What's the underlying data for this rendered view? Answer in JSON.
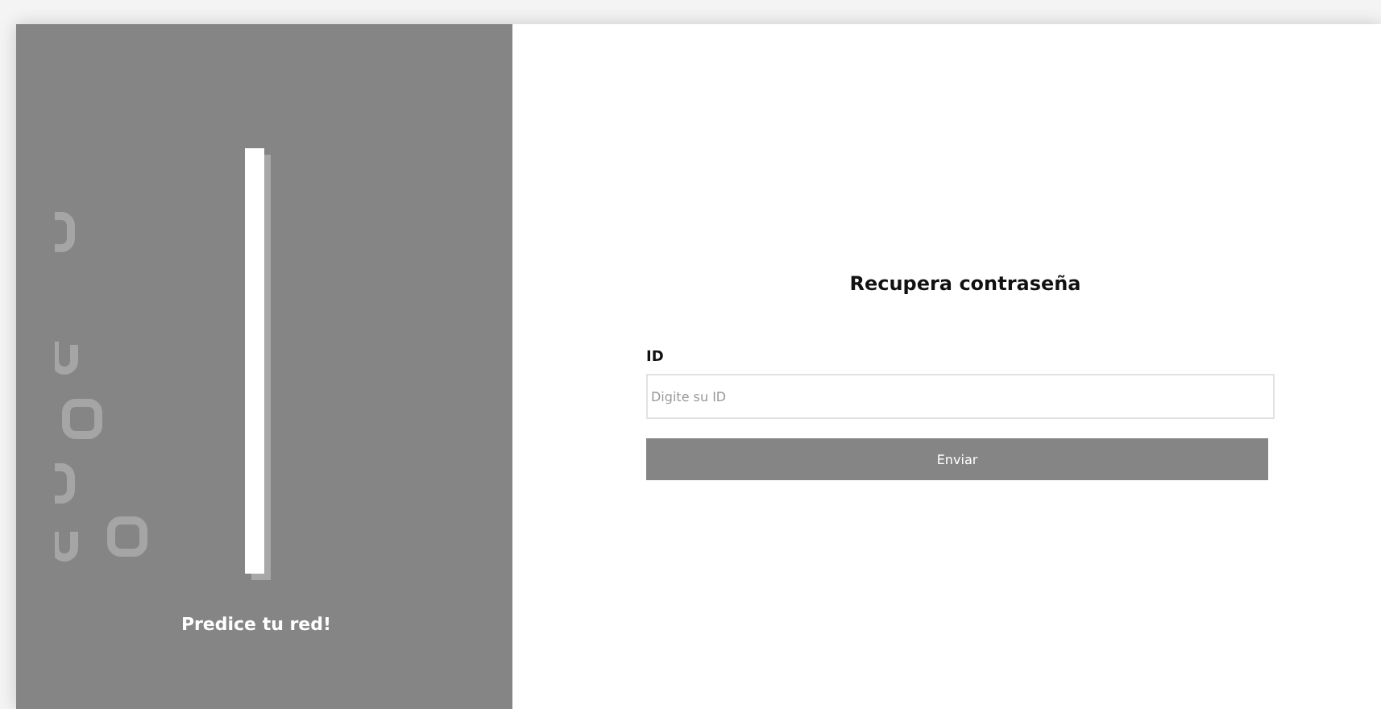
{
  "brand_panel": {
    "tagline": "Predice tu red!"
  },
  "form": {
    "title": "Recupera contraseña",
    "field": {
      "label": "ID",
      "placeholder": "Digite su ID"
    },
    "submit": "Enviar"
  }
}
